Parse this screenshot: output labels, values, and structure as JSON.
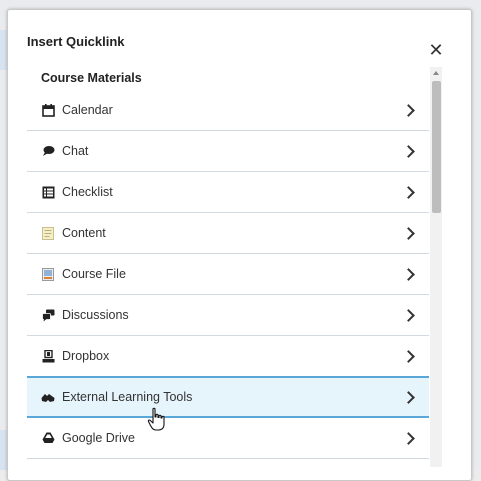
{
  "dialog": {
    "title": "Insert Quicklink",
    "close_icon": "close-icon",
    "section_title": "Course Materials",
    "items": [
      {
        "label": "Calendar",
        "icon": "calendar-icon"
      },
      {
        "label": "Chat",
        "icon": "chat-icon"
      },
      {
        "label": "Checklist",
        "icon": "checklist-icon"
      },
      {
        "label": "Content",
        "icon": "content-icon"
      },
      {
        "label": "Course File",
        "icon": "course-file-icon"
      },
      {
        "label": "Discussions",
        "icon": "discussions-icon"
      },
      {
        "label": "Dropbox",
        "icon": "dropbox-icon"
      },
      {
        "label": "External Learning Tools",
        "icon": "external-learning-tools-icon",
        "highlighted": true
      },
      {
        "label": "Google Drive",
        "icon": "google-drive-icon"
      }
    ]
  },
  "colors": {
    "highlight_bg": "#e6f4fc",
    "highlight_border": "#5aa6d6",
    "row_divider": "#d3d9e0"
  }
}
